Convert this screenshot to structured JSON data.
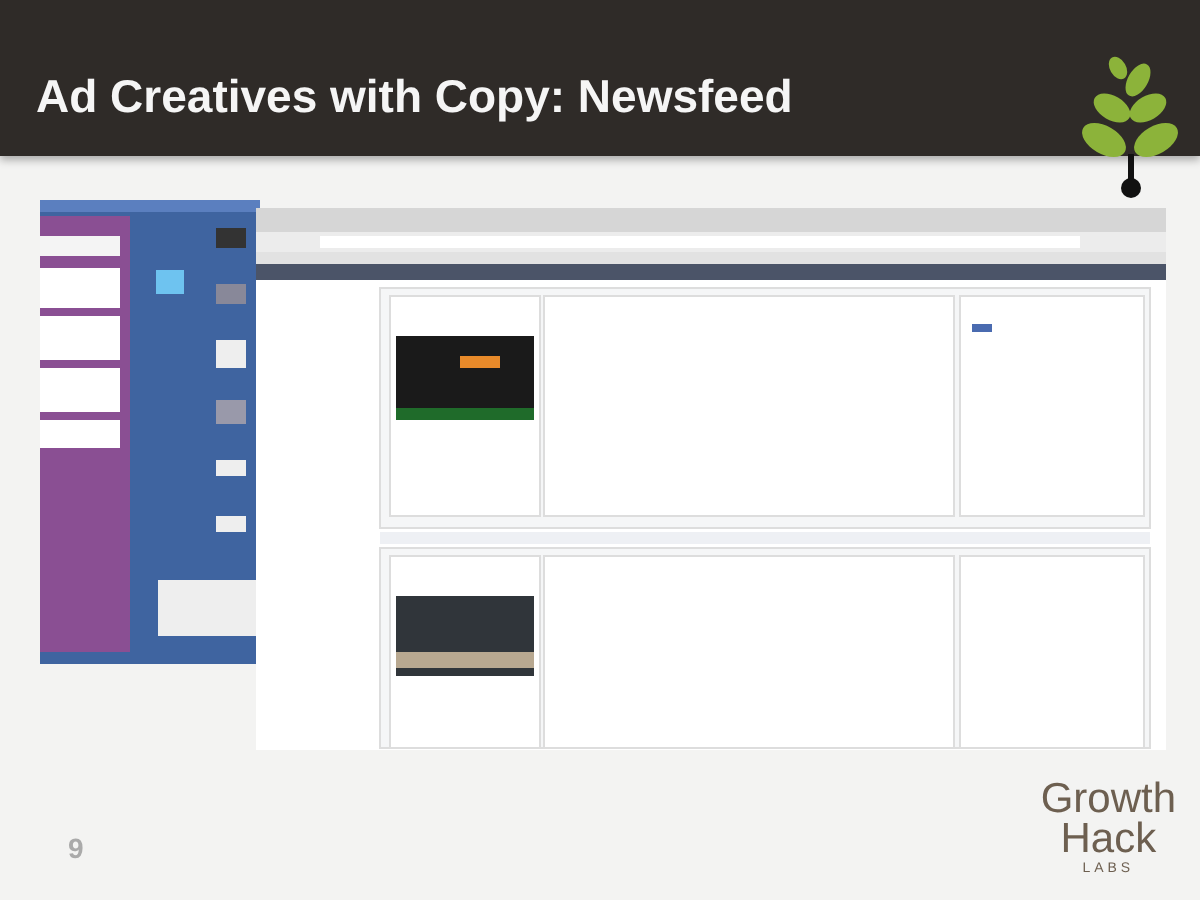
{
  "slide": {
    "title": "Ad Creatives with Copy: Newsfeed",
    "page_number": "9"
  },
  "logo": {
    "words": [
      "Growth",
      "Hack"
    ],
    "tagline": "LABS"
  }
}
